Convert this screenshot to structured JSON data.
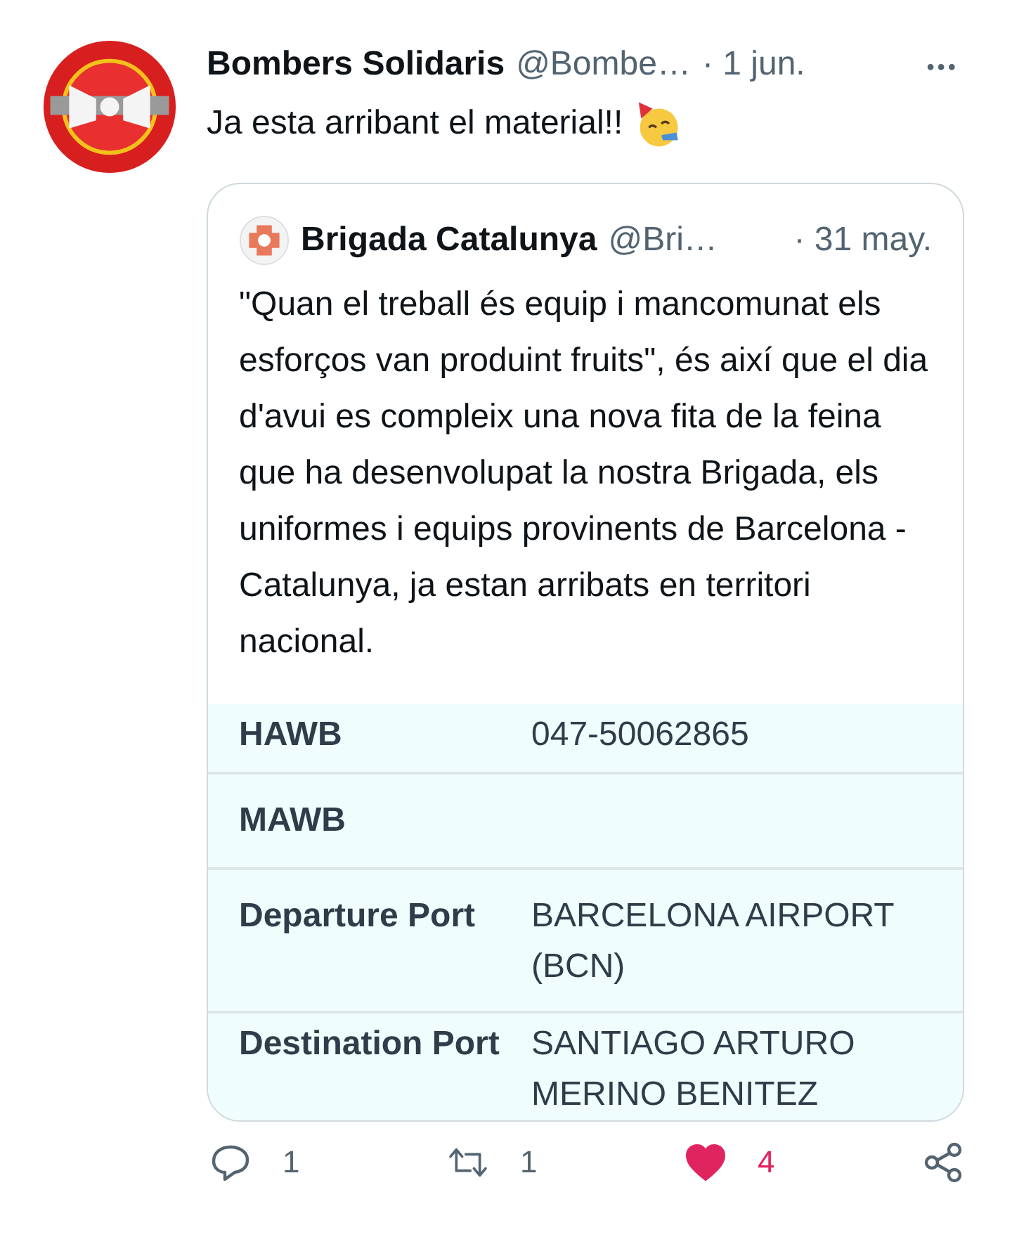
{
  "tweet": {
    "author": "Bombers Solidaris",
    "handle": "@Bombe…",
    "time": "· 1 jun.",
    "more": "•••",
    "text": "Ja esta arribant el material!!",
    "quote": {
      "author": "Brigada Catalunya",
      "handle": "@Bri…",
      "time": "· 31 may.",
      "text": "\"Quan el treball és equip i mancomunat els esforços van produint fruits\", és així que el dia d'avui es compleix una nova fita de la feina que ha desenvolupat la nostra Brigada, els uniformes i equips provinents de Barcelona - Catalunya, ja estan arribats en territori  nacional.",
      "document": [
        {
          "label": "HAWB",
          "value": "047-50062865"
        },
        {
          "label": "MAWB"
        },
        {
          "label": "Departure Port",
          "value": "BARCELONA AIRPORT (BCN)"
        },
        {
          "label": "Destination Port",
          "value": "SANTIAGO ARTURO MERINO BENITEZ"
        }
      ]
    },
    "actions": [
      {
        "kind": "reply",
        "count": "1",
        "selected": false
      },
      {
        "kind": "retweet",
        "count": "1",
        "selected": false
      },
      {
        "kind": "like",
        "count": "4",
        "selected": true
      },
      {
        "kind": "share"
      }
    ]
  }
}
